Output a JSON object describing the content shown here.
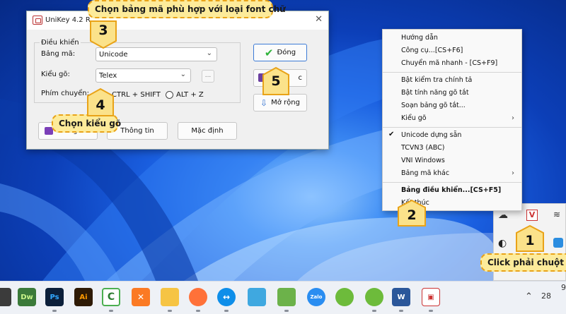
{
  "unikey": {
    "title": "UniKey 4.2 R",
    "group_title": "Điều khiển",
    "charset_label": "Bảng mã:",
    "charset_value": "Unicode",
    "input_label": "Kiểu gõ:",
    "input_value": "Telex",
    "more_button": "...",
    "switch_label": "Phím chuyển:",
    "switch_opt1": "CTRL + SHIFT",
    "switch_opt2": "ALT + Z",
    "close_button": "Đóng",
    "guide_button": "Hướng dẫn",
    "guide_button_visible": "c",
    "expand_button": "Mở rộng",
    "about_button": "Thông tin",
    "default_button": "Mặc định",
    "help_button_partial": "Hướng dẫn"
  },
  "context_menu": {
    "items": [
      {
        "label": "Hướng dẫn"
      },
      {
        "label": "Công cụ...[CS+F6]"
      },
      {
        "label": "Chuyển mã nhanh - [CS+F9]"
      },
      {
        "label": "Bật kiểm tra chính tả"
      },
      {
        "label": "Bật tính năng gõ tắt"
      },
      {
        "label": "Soạn bảng gõ tắt..."
      },
      {
        "label": "Kiểu gõ"
      },
      {
        "label": "Unicode dựng sẵn",
        "checked": true
      },
      {
        "label": "TCVN3 (ABC)"
      },
      {
        "label": "VNI Windows"
      },
      {
        "label": "Bảng mã khác"
      },
      {
        "label": "Bảng điều khiển...[CS+F5]"
      },
      {
        "label": "Kết thúc"
      }
    ]
  },
  "callouts": {
    "charset": "Chọn bảng mã phù hợp với loại font chữ",
    "input": "Chọn kiểu gõ",
    "tray": "Click phải chuột và"
  },
  "badges": [
    "1",
    "2",
    "3",
    "4",
    "5"
  ],
  "taskbar": {
    "apps": [
      "Dw",
      "Ps",
      "Ai"
    ],
    "clock_partial": "28",
    "tray_partial": "9"
  },
  "colors": {
    "callout_fill": "#fdeb9a",
    "callout_border": "#e9a318",
    "badge_fill": "#fbe28a",
    "accent_blue": "#3c7bd6",
    "check_green": "#2fb33a"
  }
}
